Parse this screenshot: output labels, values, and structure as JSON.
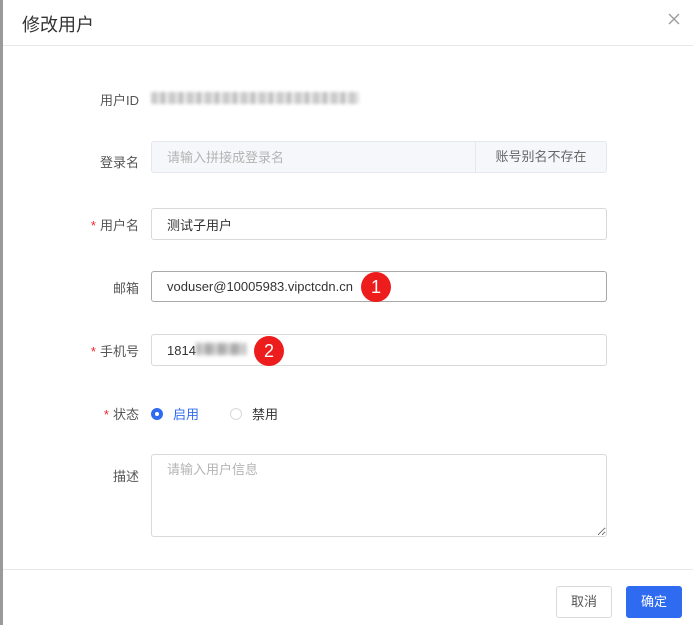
{
  "dialog": {
    "title": "修改用户"
  },
  "form": {
    "user_id": {
      "label": "用户ID"
    },
    "login_name": {
      "label": "登录名",
      "placeholder": "请输入拼接成登录名",
      "addon": "账号别名不存在"
    },
    "username": {
      "label": "用户名",
      "value": "测试子用户"
    },
    "email": {
      "label": "邮箱",
      "value": "voduser@10005983.vipctcdn.cn"
    },
    "phone": {
      "label": "手机号",
      "value": "1814"
    },
    "status": {
      "label": "状态",
      "options": [
        "启用",
        "禁用"
      ],
      "selected": "启用"
    },
    "description": {
      "label": "描述",
      "placeholder": "请输入用户信息"
    },
    "required_mark": "*"
  },
  "annotations": {
    "badge1": "1",
    "badge2": "2"
  },
  "footer": {
    "cancel": "取消",
    "confirm": "确定"
  },
  "colors": {
    "primary": "#2f6bf0",
    "required": "#f5222d",
    "badge": "#ee1d1d"
  }
}
